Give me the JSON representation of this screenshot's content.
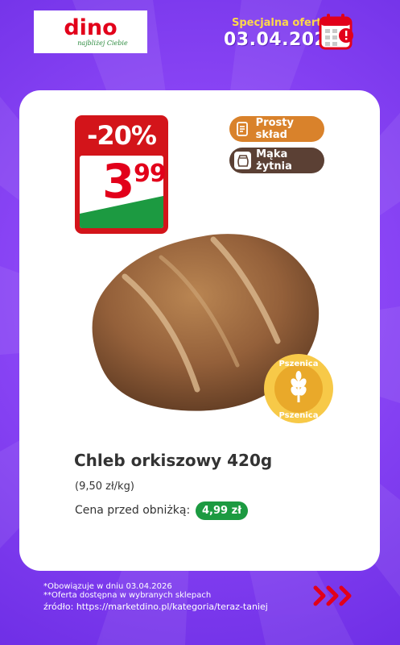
{
  "brand": {
    "name": "dino",
    "tagline": "najbliżej Ciebie",
    "color": "#e2001a"
  },
  "header": {
    "offer_label": "Specjalna oferta",
    "offer_date": "03.04.2026"
  },
  "price_tag": {
    "discount": "-20%",
    "price_main": "3",
    "price_cents": "99"
  },
  "badges": [
    {
      "label": "Prosty skład",
      "icon": "receipt-icon",
      "color": "#d9822b"
    },
    {
      "label": "Mąka żytnia",
      "icon": "flour-sack-icon",
      "color": "#5b4034"
    }
  ],
  "wheat_badge": {
    "text": "Pszenica",
    "icon": "wheat-icon"
  },
  "product": {
    "name": "Chleb orkiszowy 420g",
    "unit_price": "(9,50 zł/kg)",
    "previous_price_label": "Cena przed obniżką:",
    "previous_price": "4,99 zł"
  },
  "footer": {
    "note1": "*Obowiązuje w dniu 03.04.2026",
    "note2": "**Oferta dostępna w wybranych sklepach",
    "source": "źródło: https://marketdino.pl/kategoria/teraz-taniej"
  },
  "colors": {
    "background": "#8a45f5",
    "accent_yellow": "#ffd84a",
    "green": "#1c9a41",
    "red": "#d3141a"
  }
}
